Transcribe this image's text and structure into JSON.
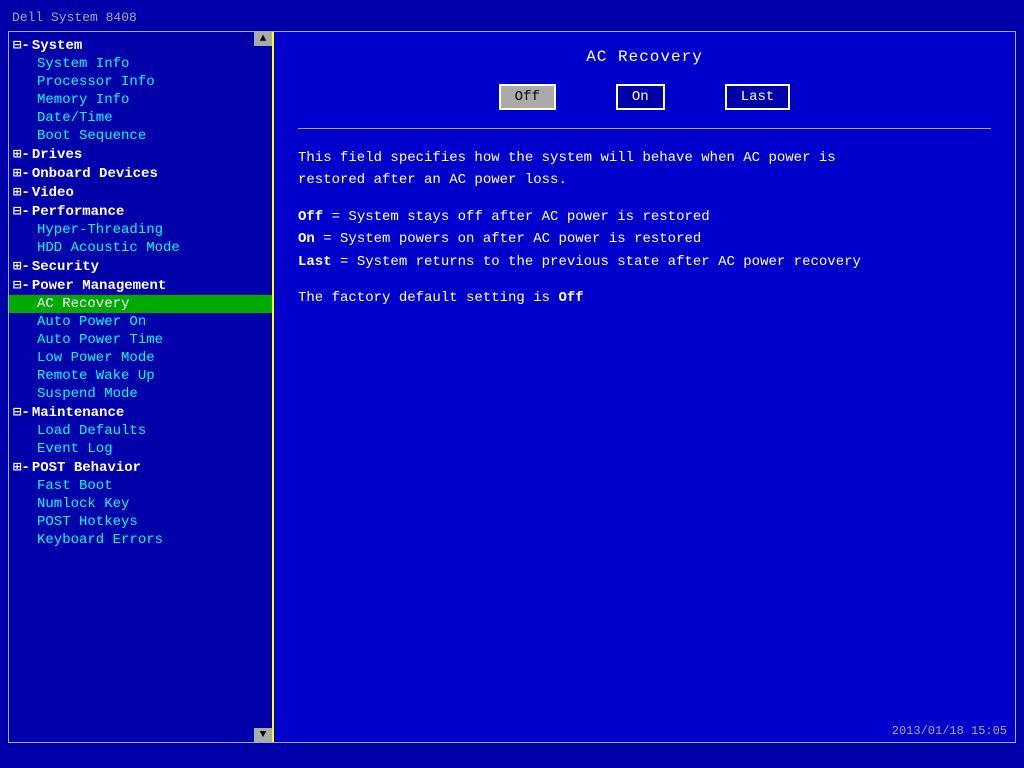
{
  "window": {
    "title": "Dell System 8408"
  },
  "sidebar": {
    "scroll_up": "▲",
    "scroll_down": "▼",
    "items": [
      {
        "id": "system",
        "label": "System",
        "type": "category",
        "prefix": "⊟-"
      },
      {
        "id": "system-info",
        "label": "System Info",
        "type": "sub",
        "prefix": ""
      },
      {
        "id": "processor-info",
        "label": "Processor Info",
        "type": "sub",
        "prefix": ""
      },
      {
        "id": "memory-info",
        "label": "Memory Info",
        "type": "sub",
        "prefix": ""
      },
      {
        "id": "date-time",
        "label": "Date/Time",
        "type": "sub",
        "prefix": ""
      },
      {
        "id": "boot-sequence",
        "label": "Boot Sequence",
        "type": "sub",
        "prefix": ""
      },
      {
        "id": "drives",
        "label": "Drives",
        "type": "category",
        "prefix": "⊞-"
      },
      {
        "id": "onboard-devices",
        "label": "Onboard Devices",
        "type": "category",
        "prefix": "⊞-"
      },
      {
        "id": "video",
        "label": "Video",
        "type": "category",
        "prefix": "⊞-"
      },
      {
        "id": "performance",
        "label": "Performance",
        "type": "category",
        "prefix": "⊟-"
      },
      {
        "id": "hyper-threading",
        "label": "Hyper-Threading",
        "type": "sub",
        "prefix": ""
      },
      {
        "id": "hdd-acoustic-mode",
        "label": "HDD Acoustic Mode",
        "type": "sub",
        "prefix": ""
      },
      {
        "id": "security",
        "label": "Security",
        "type": "category",
        "prefix": "⊞-"
      },
      {
        "id": "power-management",
        "label": "Power Management",
        "type": "category",
        "prefix": "⊟-"
      },
      {
        "id": "ac-recovery",
        "label": "AC Recovery",
        "type": "sub",
        "prefix": "",
        "active": true
      },
      {
        "id": "auto-power-on",
        "label": "Auto Power On",
        "type": "sub",
        "prefix": ""
      },
      {
        "id": "auto-power-time",
        "label": "Auto Power Time",
        "type": "sub",
        "prefix": ""
      },
      {
        "id": "low-power-mode",
        "label": "Low Power Mode",
        "type": "sub",
        "prefix": ""
      },
      {
        "id": "remote-wake-up",
        "label": "Remote Wake Up",
        "type": "sub",
        "prefix": ""
      },
      {
        "id": "suspend-mode",
        "label": "Suspend Mode",
        "type": "sub",
        "prefix": ""
      },
      {
        "id": "maintenance",
        "label": "Maintenance",
        "type": "category",
        "prefix": "⊟-"
      },
      {
        "id": "load-defaults",
        "label": "Load Defaults",
        "type": "sub",
        "prefix": ""
      },
      {
        "id": "event-log",
        "label": "Event Log",
        "type": "sub",
        "prefix": ""
      },
      {
        "id": "post-behavior",
        "label": "POST Behavior",
        "type": "category",
        "prefix": "⊞-"
      },
      {
        "id": "fast-boot",
        "label": "Fast Boot",
        "type": "sub",
        "prefix": ""
      },
      {
        "id": "numlock-key",
        "label": "Numlock Key",
        "type": "sub",
        "prefix": ""
      },
      {
        "id": "post-hotkeys",
        "label": "POST Hotkeys",
        "type": "sub",
        "prefix": ""
      },
      {
        "id": "keyboard-errors",
        "label": "Keyboard Errors",
        "type": "sub",
        "prefix": ""
      }
    ]
  },
  "content": {
    "title": "AC Recovery",
    "options": [
      {
        "id": "off",
        "label": "Off",
        "selected": true
      },
      {
        "id": "on",
        "label": "On",
        "selected": false
      },
      {
        "id": "last",
        "label": "Last",
        "selected": false
      }
    ],
    "description_line1": "This field specifies how the system will behave when AC power is",
    "description_line2": "restored after an AC power loss.",
    "option_descriptions": [
      {
        "bold": "Off",
        "text": "  = System stays off after AC power is restored"
      },
      {
        "bold": "On",
        "text": "   = System powers on after AC power is restored"
      },
      {
        "bold": "Last",
        "text": " = System returns to the previous state after AC power recovery"
      }
    ],
    "factory_default_prefix": "The factory default setting is ",
    "factory_default_value": "Off"
  },
  "status_bar": {
    "timestamp": "2013/01/18 15:05"
  }
}
